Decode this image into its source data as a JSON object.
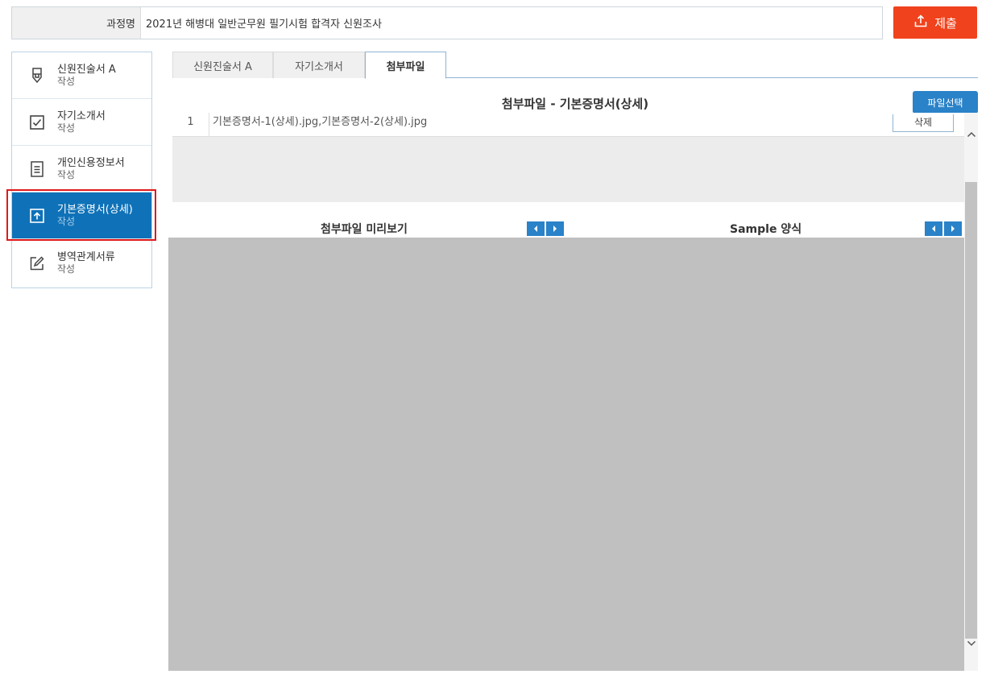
{
  "course": {
    "label": "과정명",
    "value": "2021년 해병대 일반군무원 필기시험 합격자 신원조사"
  },
  "submit": {
    "label": "제출"
  },
  "sidebar": {
    "items": [
      {
        "name": "신원진술서 A",
        "sub": "작성",
        "icon": "pen-nib-icon"
      },
      {
        "name": "자기소개서",
        "sub": "작성",
        "icon": "checkbox-icon"
      },
      {
        "name": "개인신용정보서",
        "sub": "작성",
        "icon": "document-lines-icon"
      },
      {
        "name": "기본증명서(상세)",
        "sub": "작성",
        "icon": "upload-box-icon"
      },
      {
        "name": "병역관계서류",
        "sub": "작성",
        "icon": "edit-icon"
      }
    ]
  },
  "tabs": [
    "신원진술서 A",
    "자기소개서",
    "첨부파일"
  ],
  "attachment": {
    "title": "첨부파일 - 기본증명서(상세)",
    "select_label": "파일선택",
    "files": [
      {
        "no": "1",
        "name": "기본증명서-1(상세).jpg,기본증명서-2(상세).jpg",
        "delete_label": "삭제"
      }
    ]
  },
  "preview": {
    "left_title": "첨부파일 미리보기",
    "right_title": "Sample 양식"
  },
  "colors": {
    "accent": "#0f72b8",
    "submit": "#f0421c",
    "nav": "#2a82c8",
    "highlight": "#e0191b"
  }
}
